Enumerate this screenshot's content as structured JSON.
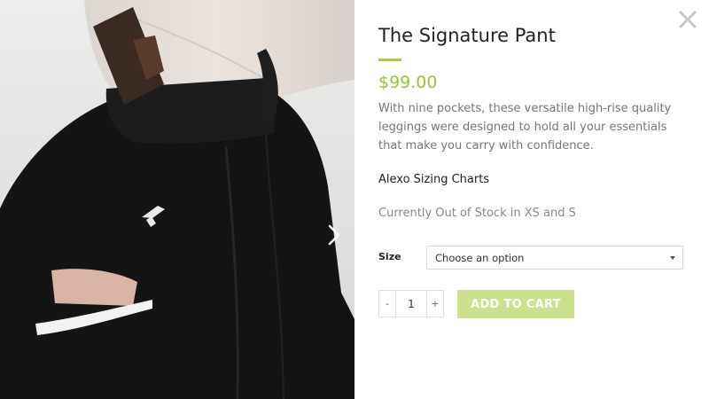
{
  "product": {
    "title": "The Signature Pant",
    "price": "$99.00",
    "description": "With nine pockets, these versatile high-rise quality leggings were designed to hold all your essentials that make you carry with confidence.",
    "sizing_link": "Alexo Sizing Charts",
    "stock_note": "Currently Out of Stock in XS and S"
  },
  "form": {
    "size_label": "Size",
    "size_selected": "Choose an option",
    "quantity": "1",
    "minus_label": "-",
    "plus_label": "+",
    "add_to_cart_label": "ADD TO CART"
  },
  "colors": {
    "accent": "#a4cf3b",
    "price": "#9bc23c",
    "add_to_cart_bg": "#cde08e"
  },
  "icons": {
    "close": "close-icon",
    "next": "chevron-right-icon"
  }
}
